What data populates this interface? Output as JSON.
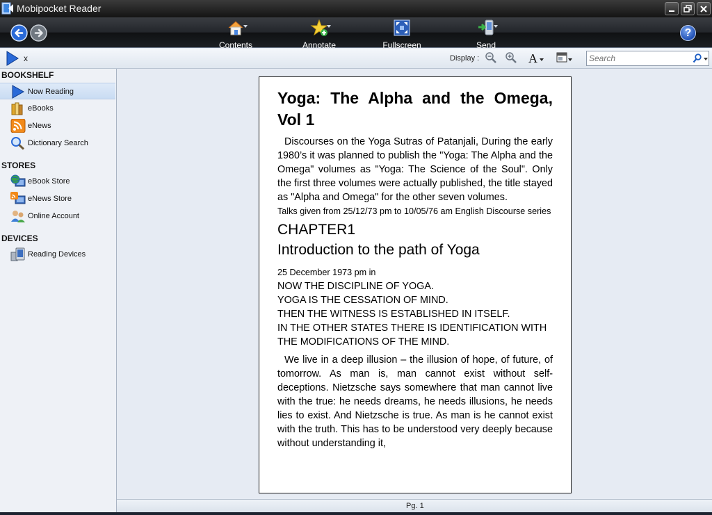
{
  "window": {
    "title": "Mobipocket Reader"
  },
  "toolbar": {
    "contents_label": "Contents",
    "annotate_label": "Annotate",
    "fullscreen_label": "Fullscreen",
    "send_label": "Send",
    "help_label": "?"
  },
  "subbar": {
    "current_book": "x",
    "display_label": "Display :",
    "font_glyph": "A"
  },
  "search": {
    "placeholder": "Search"
  },
  "sidebar": {
    "bookshelf_heading": "BOOKSHELF",
    "bookshelf_items": [
      {
        "label": "Now Reading",
        "icon": "play-arrow-icon",
        "active": true
      },
      {
        "label": "eBooks",
        "icon": "books-icon"
      },
      {
        "label": "eNews",
        "icon": "rss-icon"
      },
      {
        "label": "Dictionary Search",
        "icon": "magnifier-icon"
      }
    ],
    "stores_heading": "STORES",
    "stores_items": [
      {
        "label": "eBook Store",
        "icon": "globe-monitor-icon"
      },
      {
        "label": "eNews Store",
        "icon": "rss-monitor-icon"
      },
      {
        "label": "Online Account",
        "icon": "users-icon"
      }
    ],
    "devices_heading": "DEVICES",
    "devices_items": [
      {
        "label": "Reading Devices",
        "icon": "device-icon"
      }
    ]
  },
  "book": {
    "title": "Yoga: The Alpha and the Omega, Vol 1",
    "intro": "Discourses on the Yoga Sutras of Patanjali, During the early 1980’s it was planned to publish the \"Yoga: The Alpha and the Omega\" volumes as \"Yoga: The Science of the Soul\". Only the first three volumes were actually published, the title stayed as \"Alpha and Omega\" for the other seven volumes.",
    "talks": "Talks given from 25/12/73 pm to 10/05/76 am English Discourse series",
    "chapter_number": "CHAPTER1",
    "chapter_title": "Introduction to the path of Yoga",
    "date": "25 December 1973 pm in",
    "sutras": [
      "NOW THE DISCIPLINE OF YOGA.",
      "YOGA IS THE CESSATION OF MIND.",
      "THEN THE WITNESS IS ESTABLISHED IN ITSELF.",
      "IN THE OTHER STATES THERE IS IDENTIFICATION WITH THE MODIFICATIONS OF THE MIND."
    ],
    "body": "We live in a deep illusion – the illusion of hope, of future, of tomorrow. As man is, man cannot exist without self-deceptions. Nietzsche says somewhere that man cannot live with the true: he needs dreams, he needs illusions, he needs lies to exist. And Nietzsche is true. As man is he cannot exist with the truth. This has to be understood very deeply because without understanding it,"
  },
  "status": {
    "page": "Pg. 1"
  },
  "colors": {
    "toolbar": "#1c1f23",
    "sidebar": "#eef1f6",
    "accent": "#1f5fc4",
    "reader_bg": "#e6ebf3"
  }
}
